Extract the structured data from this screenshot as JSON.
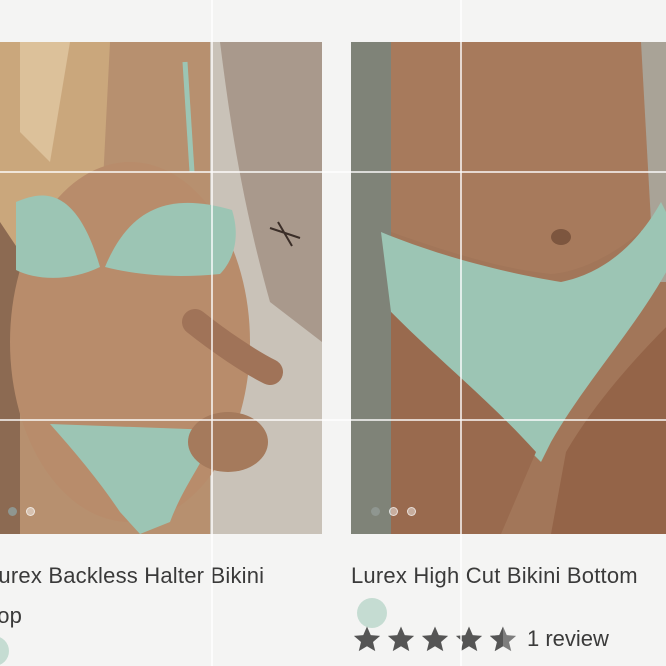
{
  "products": [
    {
      "title": "Lurex Backless Halter Bikini Top",
      "swatch_color": "#c5dcd2",
      "image_count": 2,
      "active_image": 1
    },
    {
      "title": "Lurex High Cut Bikini Bottom",
      "swatch_color": "#c5dcd2",
      "image_count": 3,
      "active_image": 1,
      "rating": 4.5,
      "review_text": "1 review"
    }
  ],
  "colors": {
    "fabric": "#9cc5b4",
    "text": "#3a3a3a",
    "star": "#555555",
    "background": "#f4f4f3"
  }
}
